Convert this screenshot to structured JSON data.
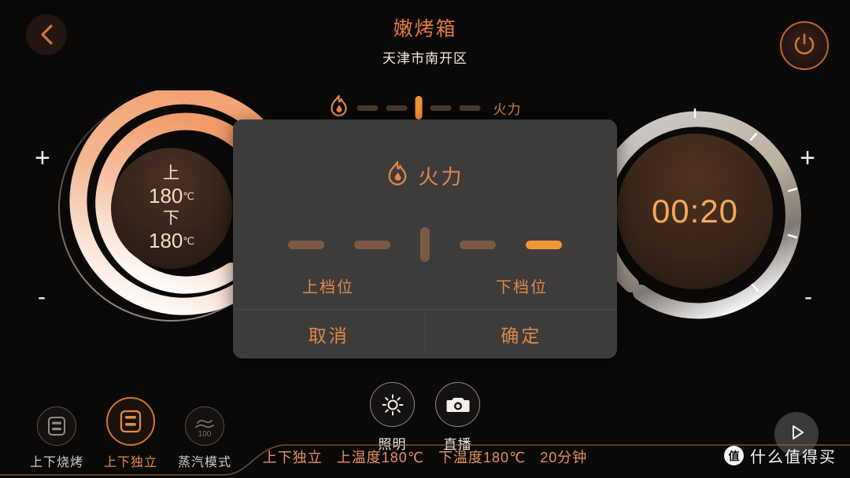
{
  "header": {
    "back_icon": "chevron-left-icon",
    "title": "嫩烤箱",
    "subtitle": "天津市南开区",
    "power_icon": "power-icon"
  },
  "fire_strip": {
    "icon": "flame-icon",
    "label": "火力",
    "segments": [
      {
        "state": "off"
      },
      {
        "state": "off"
      },
      {
        "state": "active"
      },
      {
        "state": "off"
      },
      {
        "state": "off"
      }
    ]
  },
  "left_dial": {
    "name": "temperature-dial",
    "upper_label": "上",
    "upper_value": "180",
    "upper_unit": "℃",
    "lower_label": "下",
    "lower_value": "180",
    "lower_unit": "℃",
    "plus": "+",
    "minus": "-"
  },
  "right_dial": {
    "name": "timer-dial",
    "time": "00:20",
    "plus": "+",
    "minus": "-"
  },
  "modes": [
    {
      "label": "上下烧烤",
      "icon": "grill-both-icon",
      "selected": false
    },
    {
      "label": "上下独立",
      "icon": "independent-heat-icon",
      "selected": true
    },
    {
      "label": "蒸汽模式",
      "icon": "steam-icon",
      "icon_value": "100",
      "selected": false
    }
  ],
  "center_actions": [
    {
      "label": "照明",
      "icon": "lightbulb-icon"
    },
    {
      "label": "直播",
      "icon": "camera-icon"
    }
  ],
  "play_button": {
    "icon": "play-icon"
  },
  "status_bar": {
    "items": [
      "上下独立",
      "上温度180℃",
      "下温度180℃",
      "20分钟"
    ]
  },
  "watermark": {
    "badge": "值",
    "text": "什么值得买"
  },
  "dialog": {
    "icon": "flame-icon",
    "title": "火力",
    "slider": [
      {
        "type": "bar",
        "state": "off"
      },
      {
        "type": "bar",
        "state": "off"
      },
      {
        "type": "handle",
        "state": "off"
      },
      {
        "type": "bar",
        "state": "off"
      },
      {
        "type": "bar",
        "state": "on"
      }
    ],
    "left_label": "上档位",
    "right_label": "下档位",
    "cancel": "取消",
    "confirm": "确定"
  },
  "colors": {
    "accent_orange": "#e0864a",
    "hot_orange": "#ee9733",
    "dim_brown": "#7a5a45",
    "dialog_bg": "#3e3c3b",
    "page_bg": "#0b0908",
    "temp_text": "#f4dcc4",
    "timer_text": "#f3a85c"
  }
}
